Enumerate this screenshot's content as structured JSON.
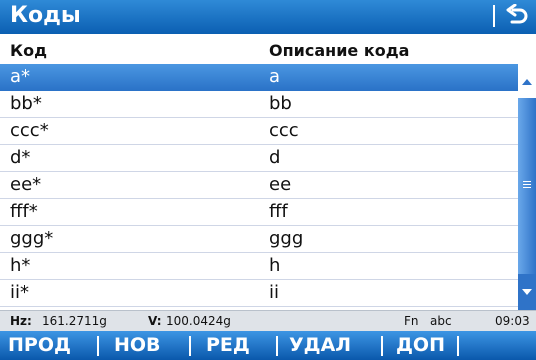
{
  "window": {
    "title": "Коды",
    "back_icon": "undo-arrow-icon"
  },
  "columns": {
    "code": "Код",
    "description": "Описание кода"
  },
  "rows": [
    {
      "code": "a*",
      "description": "a",
      "selected": true
    },
    {
      "code": "bb*",
      "description": "bb",
      "selected": false
    },
    {
      "code": "ccc*",
      "description": "ccc",
      "selected": false
    },
    {
      "code": "d*",
      "description": "d",
      "selected": false
    },
    {
      "code": "ee*",
      "description": "ee",
      "selected": false
    },
    {
      "code": "fff*",
      "description": "fff",
      "selected": false
    },
    {
      "code": "ggg*",
      "description": "ggg",
      "selected": false
    },
    {
      "code": "h*",
      "description": "h",
      "selected": false
    },
    {
      "code": "ii*",
      "description": "ii",
      "selected": false
    }
  ],
  "status": {
    "hz_label": "Hz:",
    "hz_value": "161.2711g",
    "v_label": "V:",
    "v_value": "100.0424g",
    "fn": "Fn",
    "input_mode": "abc",
    "time": "09:03"
  },
  "softkeys": [
    {
      "label": "ПРОД"
    },
    {
      "label": "НОВ"
    },
    {
      "label": "РЕД"
    },
    {
      "label": "УДАЛ"
    },
    {
      "label": "ДОП"
    }
  ],
  "colors": {
    "title_bar": "#1f74c8",
    "selection": "#3a86d8",
    "softkey_bar": "#0b5fb2",
    "status_bar": "#dfe3e8"
  }
}
